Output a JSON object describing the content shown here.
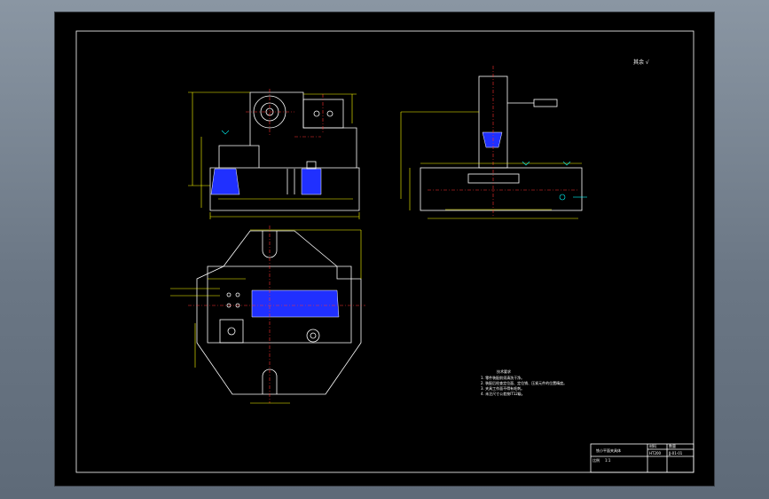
{
  "drawing": {
    "roughness_note": "其余 √",
    "notes_title": "技术要求",
    "notes": [
      "1. 零件装配前须清洗干净。",
      "2. 装配后检查定位面、定位销、压紧元件的位置精度。",
      "3. 夹具工作面不得有毛刺。",
      "4. 未注尺寸公差按IT12级。"
    ]
  },
  "title_block": {
    "name": "铣小平面夹具体",
    "material_label": "材料",
    "material_value": "HT200",
    "scale_label": "比例",
    "scale_value": "1:1",
    "qty_label": "数量",
    "drawing_no": "JJ-01-01"
  },
  "colors": {
    "background": "#000000",
    "outline": "#ffffff",
    "dimension": "#ffff00",
    "centerline": "#ff3030",
    "section_hatch": "#2030ff",
    "annotation": "#00ffff"
  }
}
